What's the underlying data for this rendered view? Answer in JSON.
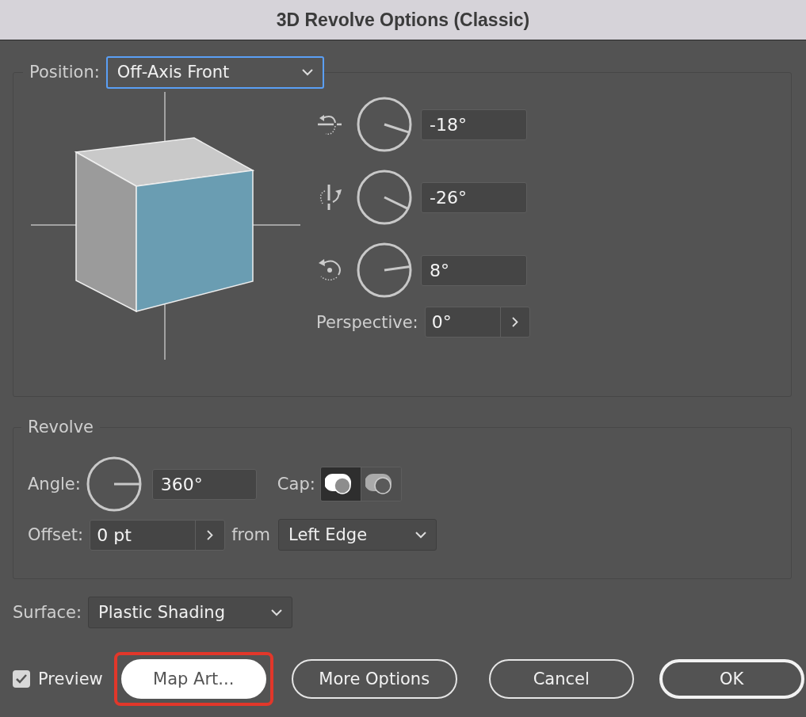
{
  "window": {
    "title": "3D Revolve Options (Classic)"
  },
  "position": {
    "label": "Position:",
    "value": "Off-Axis Front",
    "focused": true
  },
  "rotations": [
    {
      "kind": "horizontal",
      "value": "-18°"
    },
    {
      "kind": "vertical",
      "value": "-26°"
    },
    {
      "kind": "around",
      "value": "8°"
    }
  ],
  "perspective": {
    "label": "Perspective:",
    "value": "0°"
  },
  "revolve": {
    "title": "Revolve",
    "angle": {
      "label": "Angle:",
      "value": "360°"
    },
    "cap": {
      "label": "Cap:",
      "options": [
        {
          "kind": "on",
          "selected": true
        },
        {
          "kind": "off",
          "selected": false
        }
      ]
    },
    "offset": {
      "label": "Offset:",
      "value": "0 pt"
    },
    "from": {
      "label": "from",
      "value": "Left Edge"
    }
  },
  "surface": {
    "label": "Surface:",
    "value": "Plastic Shading"
  },
  "preview": {
    "label": "Preview",
    "checked": true
  },
  "buttons": [
    {
      "label": "Map Art...",
      "kind": "filled",
      "highlighted": true
    },
    {
      "label": "More Options",
      "kind": "outline",
      "highlighted": false
    },
    {
      "label": "Cancel",
      "kind": "outline",
      "highlighted": false
    },
    {
      "label": "OK",
      "kind": "default",
      "highlighted": false
    }
  ]
}
